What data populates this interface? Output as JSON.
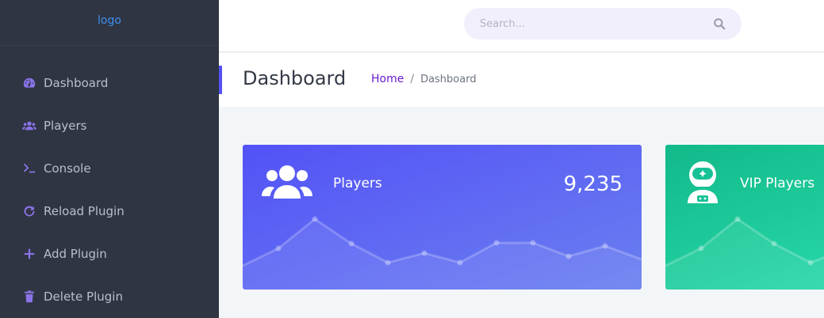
{
  "sidebar": {
    "logo": "logo",
    "items": [
      {
        "label": "Dashboard",
        "icon": "dashboard-gauge-icon"
      },
      {
        "label": "Players",
        "icon": "users-icon"
      },
      {
        "label": "Console",
        "icon": "terminal-icon"
      },
      {
        "label": "Reload Plugin",
        "icon": "reload-icon"
      },
      {
        "label": "Add Plugin",
        "icon": "plus-icon"
      },
      {
        "label": "Delete Plugin",
        "icon": "trash-icon"
      }
    ]
  },
  "search": {
    "placeholder": "Search...",
    "value": ""
  },
  "header": {
    "title": "Dashboard",
    "breadcrumb": {
      "home": "Home",
      "separator": "/",
      "current": "Dashboard"
    }
  },
  "cards": [
    {
      "label": "Players",
      "value": "9,235",
      "icon": "users-icon",
      "color_start": "#5352f6",
      "color_end": "#6a7ff0"
    },
    {
      "label": "VIP Players",
      "value": "",
      "icon": "astronaut-icon",
      "color_start": "#12b98a",
      "color_end": "#27d8a8"
    }
  ],
  "colors": {
    "sidebar_bg": "#2f3542",
    "nav_icon": "#8a73e8",
    "accent": "#5651f5",
    "link": "#6a1bd0",
    "logo": "#3e8ef0"
  }
}
